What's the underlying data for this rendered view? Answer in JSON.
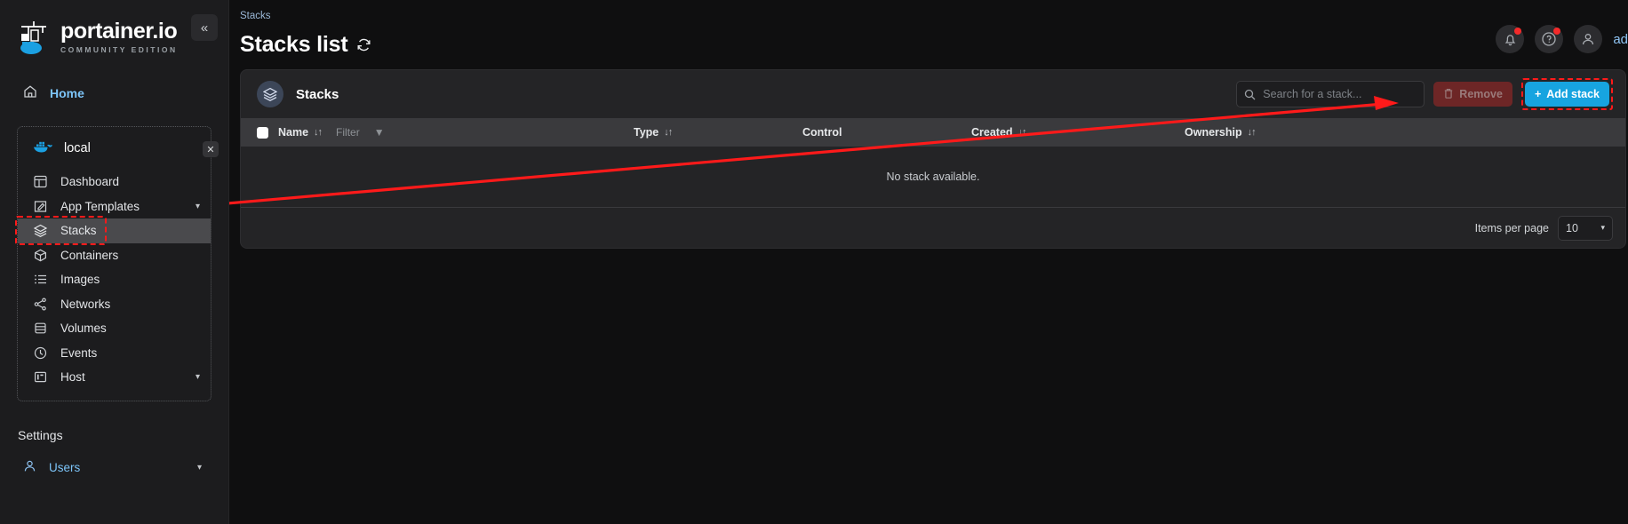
{
  "sidebar": {
    "brand": {
      "title": "portainer.io",
      "subtitle": "COMMUNITY EDITION",
      "logo_icon": "portainer-whale-crane-logo"
    },
    "collapse_icon": "double-chevron-left-icon",
    "home": {
      "label": "Home",
      "icon": "home-icon"
    },
    "environment": {
      "name": "local",
      "icon": "docker-whale-icon",
      "close_icon": "close-icon"
    },
    "items": [
      {
        "label": "Dashboard",
        "icon": "dashboard-icon",
        "active": false,
        "expandable": false
      },
      {
        "label": "App Templates",
        "icon": "app-templates-icon",
        "active": false,
        "expandable": true
      },
      {
        "label": "Stacks",
        "icon": "stacks-layers-icon",
        "active": true,
        "expandable": false
      },
      {
        "label": "Containers",
        "icon": "containers-cube-icon",
        "active": false,
        "expandable": false
      },
      {
        "label": "Images",
        "icon": "images-list-icon",
        "active": false,
        "expandable": false
      },
      {
        "label": "Networks",
        "icon": "networks-share-icon",
        "active": false,
        "expandable": false
      },
      {
        "label": "Volumes",
        "icon": "volumes-database-icon",
        "active": false,
        "expandable": false
      },
      {
        "label": "Events",
        "icon": "events-clock-icon",
        "active": false,
        "expandable": false
      },
      {
        "label": "Host",
        "icon": "host-server-icon",
        "active": false,
        "expandable": true
      }
    ],
    "settings_label": "Settings",
    "users": {
      "label": "Users",
      "icon": "users-icon"
    }
  },
  "header": {
    "breadcrumb": "Stacks",
    "title": "Stacks list",
    "refresh_icon": "refresh-icon",
    "notifications_icon": "bell-icon",
    "help_icon": "help-question-icon",
    "avatar_icon": "user-avatar-icon",
    "user_name": "ad"
  },
  "panel": {
    "icon": "stacks-layers-icon",
    "title": "Stacks",
    "search": {
      "value": "",
      "placeholder": "Search for a stack...",
      "icon": "search-icon"
    },
    "remove_button": {
      "label": "Remove",
      "icon": "trash-icon",
      "disabled": true
    },
    "add_button": {
      "label": "Add stack",
      "icon": "plus-icon"
    },
    "table": {
      "select_all_checkbox": true,
      "columns": [
        {
          "label": "Name",
          "sortable": true,
          "sort_icon": "sort-arrows-icon",
          "filter_label": "Filter",
          "filter_icon": "funnel-icon"
        },
        {
          "label": "Type",
          "sortable": true,
          "sort_icon": "sort-arrows-icon"
        },
        {
          "label": "Control",
          "sortable": false
        },
        {
          "label": "Created",
          "sortable": true,
          "sort_icon": "sort-arrows-icon"
        },
        {
          "label": "Ownership",
          "sortable": true,
          "sort_icon": "sort-arrows-icon"
        }
      ],
      "rows": [],
      "empty_message": "No stack available."
    },
    "footer": {
      "items_per_page_label": "Items per page",
      "items_per_page_value": "10",
      "chevron_icon": "chevron-down-icon"
    }
  },
  "annotations": {
    "highlight_color": "#ff1a1a",
    "arrow_icon": "red-arrow-pointer",
    "targets": [
      "sidebar-item-stacks",
      "add-stack-button"
    ]
  }
}
